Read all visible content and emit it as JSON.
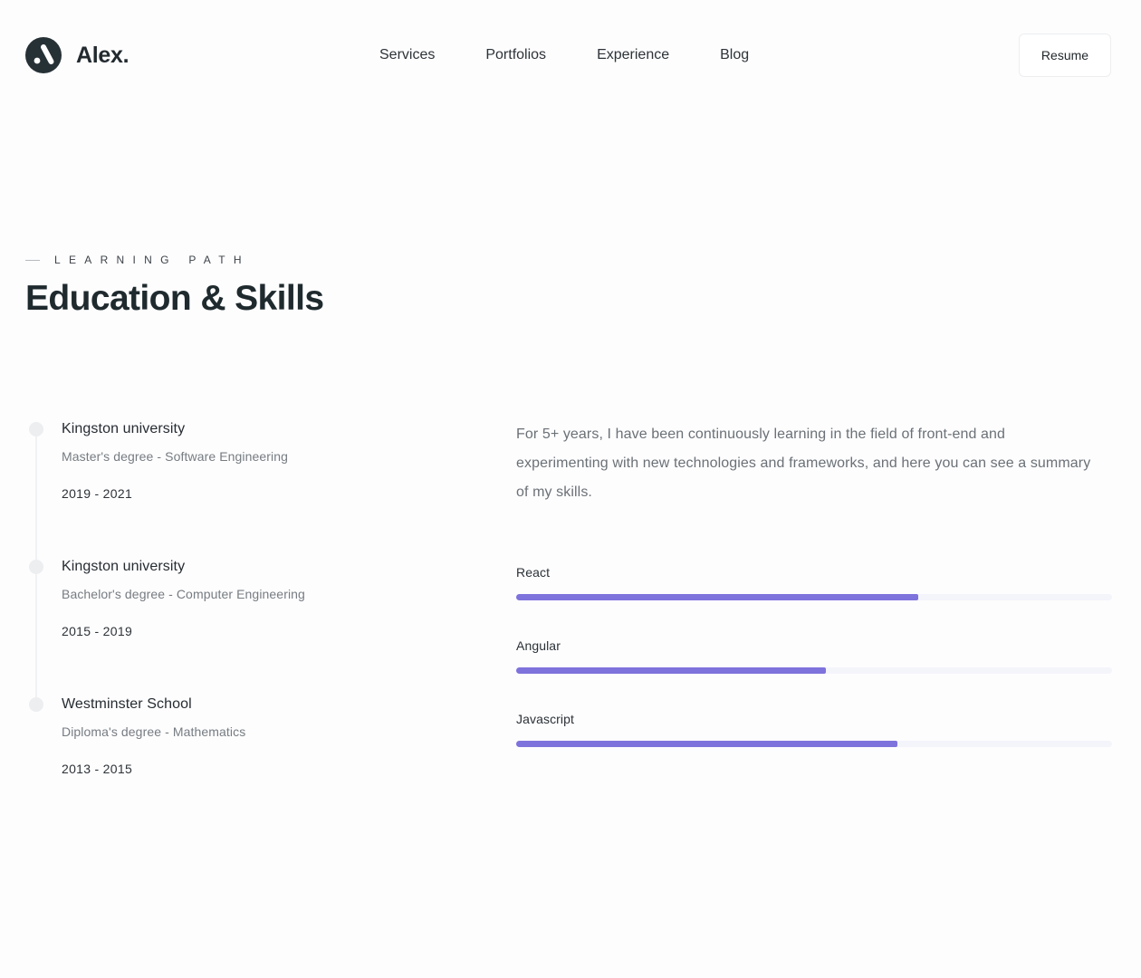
{
  "brand": {
    "name": "Alex.",
    "icon": "logo-mark-icon"
  },
  "nav": {
    "items": [
      "Services",
      "Portfolios",
      "Experience",
      "Blog"
    ]
  },
  "header": {
    "resume_label": "Resume"
  },
  "section": {
    "eyebrow": "Learning Path",
    "title": "Education & Skills"
  },
  "education": [
    {
      "school": "Kingston university",
      "degree": "Master's degree - Software Engineering",
      "years": "2019 - 2021"
    },
    {
      "school": "Kingston university",
      "degree": "Bachelor's degree - Computer Engineering",
      "years": "2015 - 2019"
    },
    {
      "school": "Westminster School",
      "degree": "Diploma's degree - Mathematics",
      "years": "2013 - 2015"
    }
  ],
  "skills": {
    "intro": "For 5+ years, I have been continuously learning in the field of front-end and experimenting with new technologies and frameworks, and here you can see a summary of my skills.",
    "items": [
      {
        "name": "React",
        "level": 0.675
      },
      {
        "name": "Angular",
        "level": 0.52
      },
      {
        "name": "Javascript",
        "level": 0.64
      }
    ]
  },
  "colors": {
    "accent": "#7e72dc",
    "track": "#f4f4fb",
    "logo_bg": "#263136",
    "text_dark": "#1f2a2e",
    "text_muted": "#6b7176"
  }
}
